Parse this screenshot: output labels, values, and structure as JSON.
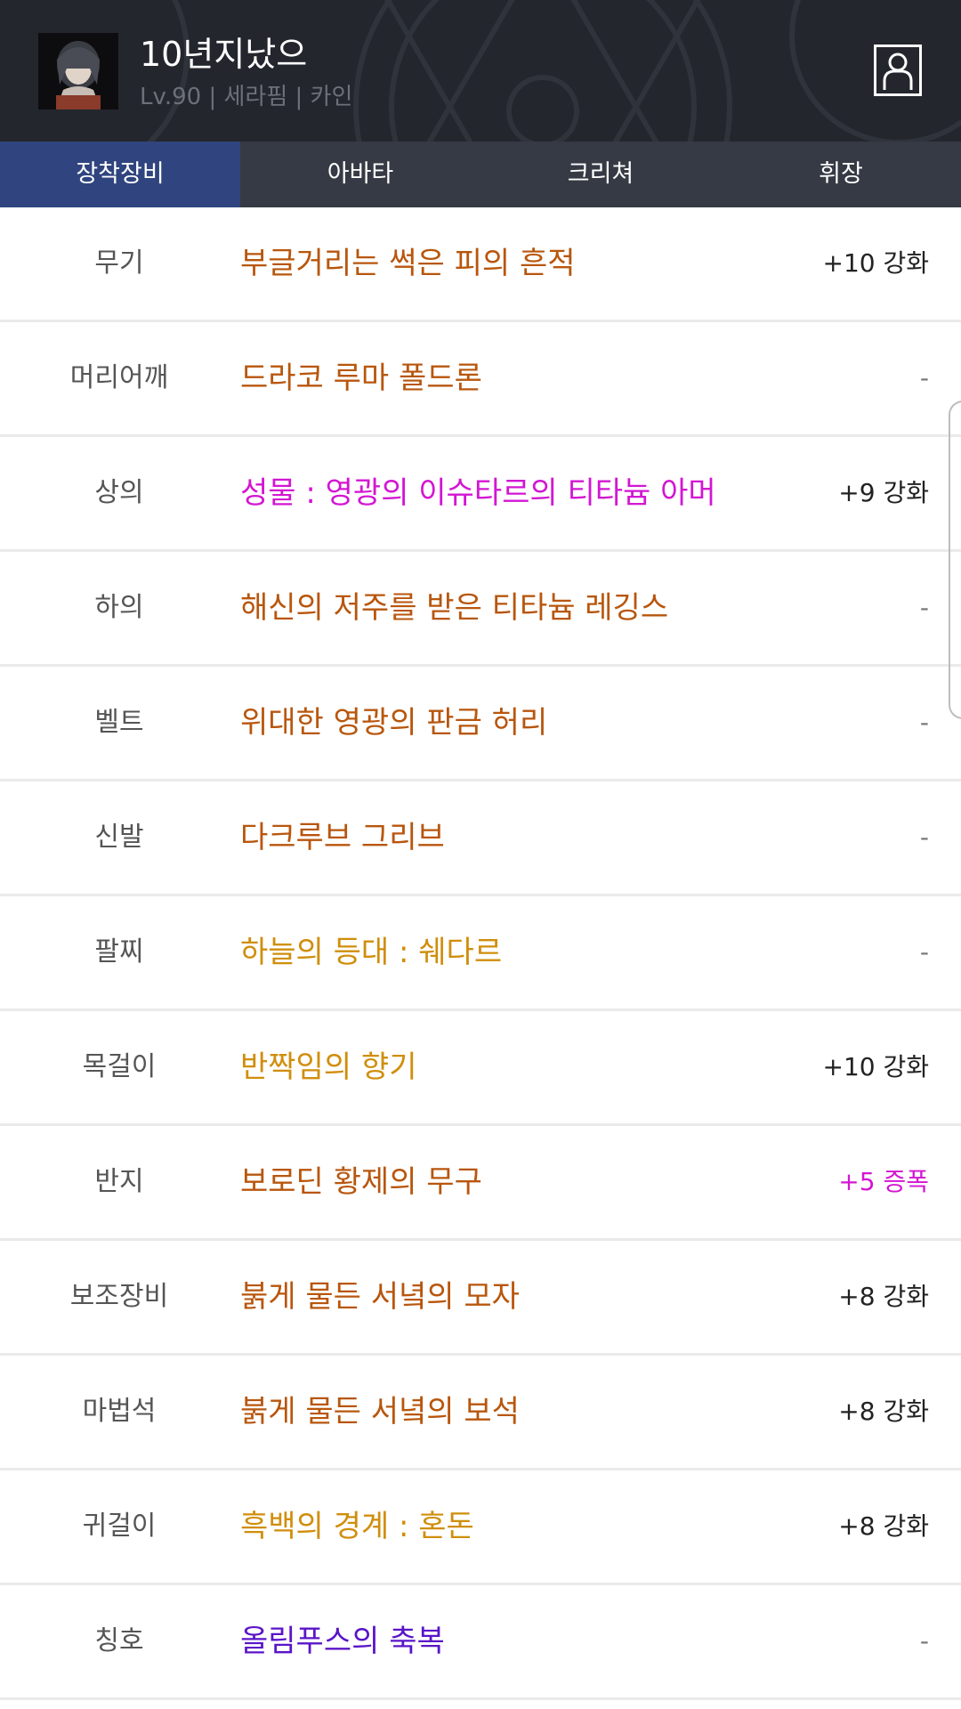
{
  "header": {
    "character_name": "10년지났으",
    "character_info": "Lv.90 | 세라핌 | 카인"
  },
  "tabs": [
    {
      "label": "장착장비",
      "active": true
    },
    {
      "label": "아바타",
      "active": false
    },
    {
      "label": "크리쳐",
      "active": false
    },
    {
      "label": "휘장",
      "active": false
    }
  ],
  "colors": {
    "unique": "#b8560d",
    "legendary": "#d08e0c",
    "epic": "#d316d3",
    "rare": "#5a14c8",
    "active_tab": "#30457f"
  },
  "equipment": [
    {
      "slot": "무기",
      "item": "부글거리는 썩은 피의 흔적",
      "color": "#b8560d",
      "enhance": "+10 강화",
      "enhance_color": "#222222"
    },
    {
      "slot": "머리어깨",
      "item": "드라코 루마 폴드론",
      "color": "#b8560d",
      "enhance": "-",
      "enhance_color": "#777777"
    },
    {
      "slot": "상의",
      "item": "성물 : 영광의 이슈타르의 티타늄 아머",
      "color": "#d316d3",
      "enhance": "+9 강화",
      "enhance_color": "#222222"
    },
    {
      "slot": "하의",
      "item": "해신의 저주를 받은 티타늄 레깅스",
      "color": "#b8560d",
      "enhance": "-",
      "enhance_color": "#777777"
    },
    {
      "slot": "벨트",
      "item": "위대한 영광의 판금 허리",
      "color": "#b8560d",
      "enhance": "-",
      "enhance_color": "#777777"
    },
    {
      "slot": "신발",
      "item": "다크루브 그리브",
      "color": "#b8560d",
      "enhance": "-",
      "enhance_color": "#777777"
    },
    {
      "slot": "팔찌",
      "item": "하늘의 등대 : 쉐다르",
      "color": "#d08e0c",
      "enhance": "-",
      "enhance_color": "#777777"
    },
    {
      "slot": "목걸이",
      "item": "반짝임의 향기",
      "color": "#d08e0c",
      "enhance": "+10 강화",
      "enhance_color": "#222222"
    },
    {
      "slot": "반지",
      "item": "보로딘 황제의 무구",
      "color": "#b8560d",
      "enhance": "+5 증폭",
      "enhance_color": "#d316d3"
    },
    {
      "slot": "보조장비",
      "item": "붉게 물든 서녘의 모자",
      "color": "#b8560d",
      "enhance": "+8 강화",
      "enhance_color": "#222222"
    },
    {
      "slot": "마법석",
      "item": "붉게 물든 서녘의 보석",
      "color": "#b8560d",
      "enhance": "+8 강화",
      "enhance_color": "#222222"
    },
    {
      "slot": "귀걸이",
      "item": "흑백의 경계 : 혼돈",
      "color": "#d08e0c",
      "enhance": "+8 강화",
      "enhance_color": "#222222"
    },
    {
      "slot": "칭호",
      "item": "올림푸스의 축복",
      "color": "#5a14c8",
      "enhance": "-",
      "enhance_color": "#777777"
    }
  ]
}
